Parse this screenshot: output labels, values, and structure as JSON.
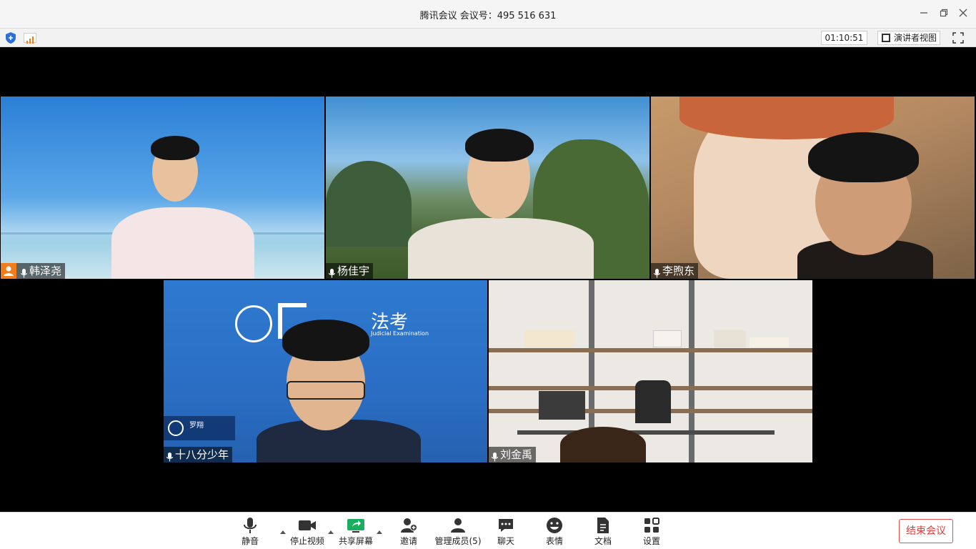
{
  "window": {
    "title": "腾讯会议 会议号：495 516 631",
    "minimize_icon": "minimize-icon",
    "restore_icon": "restore-icon",
    "close_icon": "close-icon"
  },
  "status_bar": {
    "timer": "01:10:51",
    "view_label": "演讲者视图",
    "security_icon": "shield-icon",
    "signal_icon": "signal-icon",
    "fullscreen_icon": "fullscreen-icon"
  },
  "participants": [
    {
      "name": "韩泽尧",
      "is_host": true,
      "mic": "on"
    },
    {
      "name": "杨佳宇",
      "is_host": false,
      "mic": "on"
    },
    {
      "name": "李煦东",
      "is_host": false,
      "mic": "on"
    },
    {
      "name": "十八分少年",
      "is_host": false,
      "mic": "on"
    },
    {
      "name": "刘金禹",
      "is_host": false,
      "mic": "on"
    }
  ],
  "background_text": {
    "brand": "法考",
    "brand_sub": "Judicial Examination",
    "lecturer": "罗翔"
  },
  "toolbar": {
    "mute": "静音",
    "stop_video": "停止视频",
    "share_screen": "共享屏幕",
    "invite": "邀请",
    "members": "管理成员(5)",
    "chat": "聊天",
    "emoji": "表情",
    "docs": "文档",
    "settings": "设置",
    "end_meeting": "结束会议"
  },
  "colors": {
    "accent_green": "#1aae5e",
    "end_red": "#e03c3c",
    "host_orange": "#f07c1c",
    "security_blue": "#2b6fd8"
  }
}
